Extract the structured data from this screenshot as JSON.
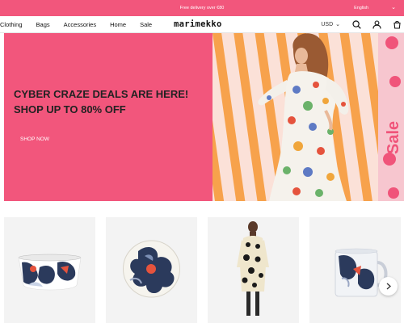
{
  "topbar": {
    "promo": "Free delivery over €80",
    "language": "English",
    "language_caret": "⌄"
  },
  "nav": {
    "items": [
      "Clothing",
      "Bags",
      "Accessories",
      "Home",
      "Sale"
    ]
  },
  "brand": {
    "logo": "marimekko"
  },
  "header": {
    "currency": "USD",
    "currency_caret": "⌄",
    "icons": [
      "search-icon",
      "user-icon",
      "cart-icon"
    ]
  },
  "hero": {
    "headline_line1": "CYBER CRAZE DEALS ARE HERE!",
    "headline_line2": "SHOP UP TO 80% OFF",
    "cta": "SHOP NOW",
    "image_text": "Sale"
  },
  "products": {
    "cards": [
      "bowl-product",
      "plate-product",
      "dress-product",
      "mug-product"
    ],
    "next_arrow": "chevron-right-icon"
  },
  "colors": {
    "brand_pink": "#f2567c",
    "hero_orange": "#f6a04a",
    "unikko_navy": "#2b3a5c",
    "unikko_red": "#e5533d"
  }
}
